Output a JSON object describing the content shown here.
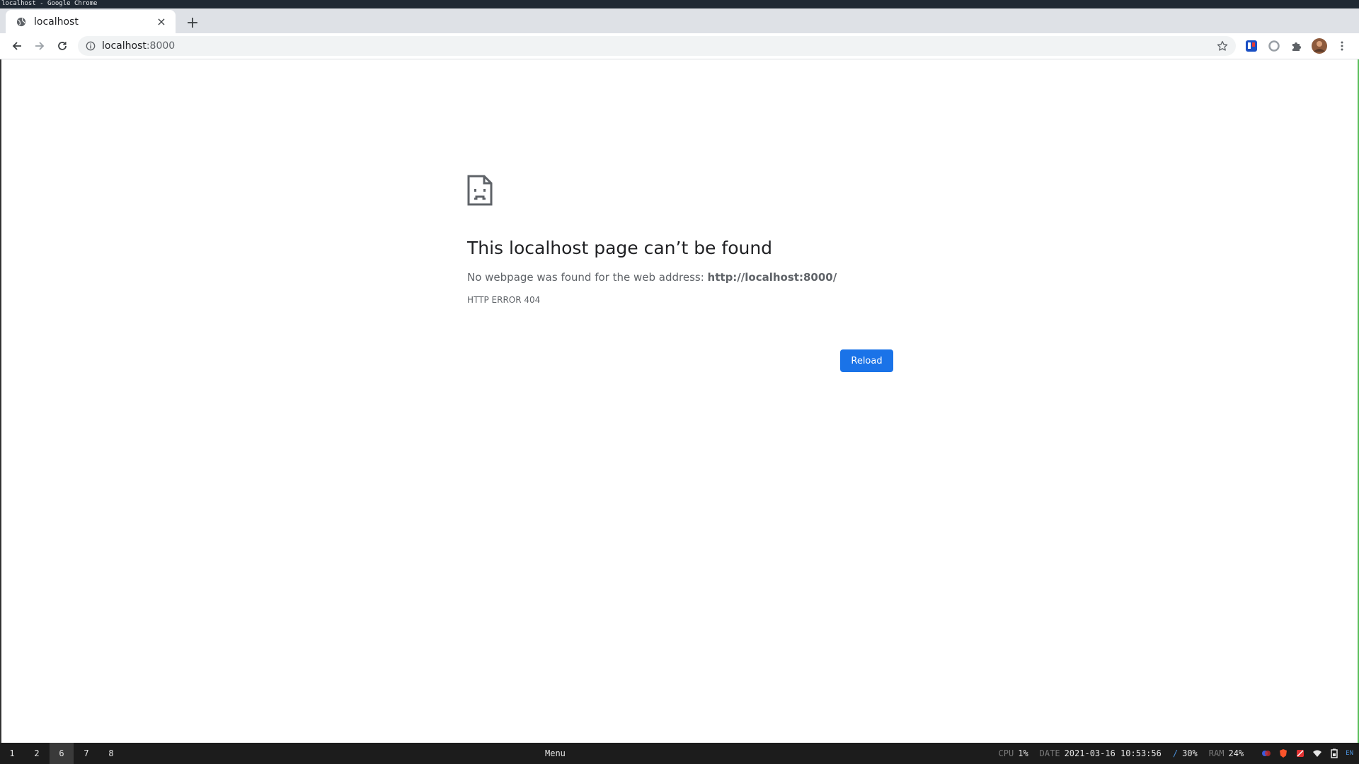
{
  "window": {
    "title": "localhost - Google Chrome"
  },
  "tab": {
    "title": "localhost",
    "close_glyph": "×",
    "favicon": "globe-icon"
  },
  "new_tab_glyph": "+",
  "omnibox": {
    "host": "localhost",
    "port": ":8000"
  },
  "error": {
    "heading": "This localhost page can’t be found",
    "desc_prefix": "No webpage was found for the web address: ",
    "url": "http://localhost:8000/",
    "code": "HTTP ERROR 404",
    "reload_label": "Reload"
  },
  "taskbar": {
    "workspaces": [
      {
        "label": "1",
        "active": false
      },
      {
        "label": "2",
        "active": false
      },
      {
        "label": "6",
        "active": true
      },
      {
        "label": "7",
        "active": false
      },
      {
        "label": "8",
        "active": false
      }
    ],
    "menu_label": "Menu",
    "cpu_label": "CPU",
    "cpu_value": "1%",
    "date_label": "DATE",
    "date_value": "2021-03-16 10:53:56",
    "disk_label": "/",
    "disk_value": "30%",
    "ram_label": "RAM",
    "ram_value": "24%",
    "lang": "EN"
  },
  "colors": {
    "accent": "#1a73e8",
    "tabstrip": "#dee1e6",
    "statusbar": "#1c1c1c"
  }
}
